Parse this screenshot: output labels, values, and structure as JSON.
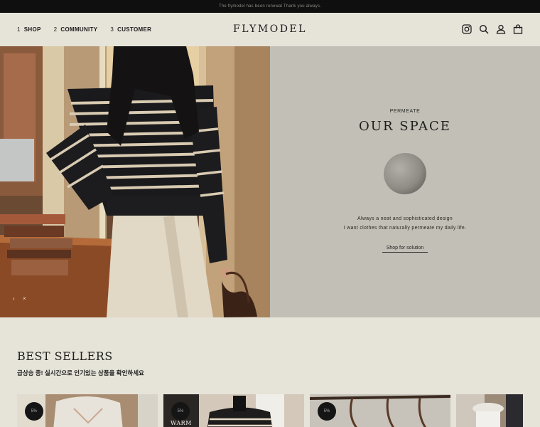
{
  "announcement": "The flymodel has been renewal Thank you always.",
  "nav": [
    {
      "num": "1",
      "label": "SHOP"
    },
    {
      "num": "2",
      "label": "COMMUNITY"
    },
    {
      "num": "3",
      "label": "CUSTOMER"
    }
  ],
  "logo": "FLYMODEL",
  "icons": [
    "instagram-icon",
    "search-icon",
    "user-icon",
    "bag-icon"
  ],
  "hero": {
    "eyebrow": "PERMEATE",
    "title": "OUR SPACE",
    "desc_line1": "Always a neat and sophisticated design",
    "desc_line2": "I want clothes that naturally permeate my daily life.",
    "link": "Shop for solution",
    "prev": "‹",
    "next": "×"
  },
  "best_sellers": {
    "title": "BEST SELLERS",
    "subtitle": "급상승 중! 실시간으로 인기있는 상품을 확인하세요",
    "cards": [
      {
        "badge": "5%"
      },
      {
        "badge": "5%",
        "caption": "WARM"
      },
      {
        "badge": "5%"
      },
      {
        "badge": ""
      }
    ]
  },
  "colors": {
    "background": "#e6e3d9",
    "hero_panel": "#c2c0b6",
    "topbar": "#0f0f0f"
  }
}
